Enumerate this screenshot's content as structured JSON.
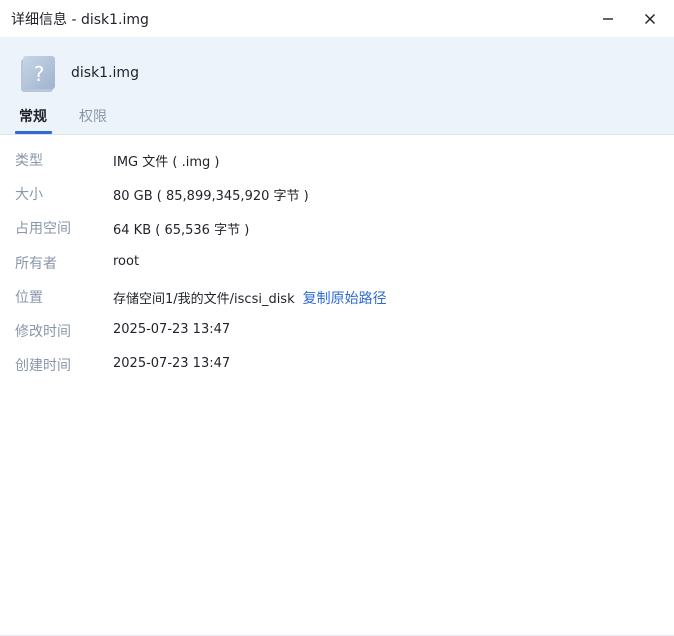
{
  "window": {
    "title": "详细信息 - disk1.img",
    "minimize_icon": "minimize-icon",
    "close_icon": "close-icon"
  },
  "file": {
    "name": "disk1.img",
    "icon": "unknown-file-icon"
  },
  "tabs": [
    {
      "label": "常规",
      "active": true
    },
    {
      "label": "权限",
      "active": false
    }
  ],
  "details": {
    "type": {
      "label": "类型",
      "value": "IMG 文件 ( .img )"
    },
    "size": {
      "label": "大小",
      "value": "80 GB ( 85,899,345,920 字节 )"
    },
    "used": {
      "label": "占用空间",
      "value": "64 KB ( 65,536 字节 )"
    },
    "owner": {
      "label": "所有者",
      "value": "root"
    },
    "location": {
      "label": "位置",
      "value": "存储空间1/我的文件/iscsi_disk",
      "link": "复制原始路径"
    },
    "modified": {
      "label": "修改时间",
      "value": "2025-07-23 13:47"
    },
    "created": {
      "label": "创建时间",
      "value": "2025-07-23 13:47"
    }
  },
  "colors": {
    "accent": "#2f6bd1",
    "header_bg": "#edf3fa",
    "label": "#8a97a8"
  }
}
